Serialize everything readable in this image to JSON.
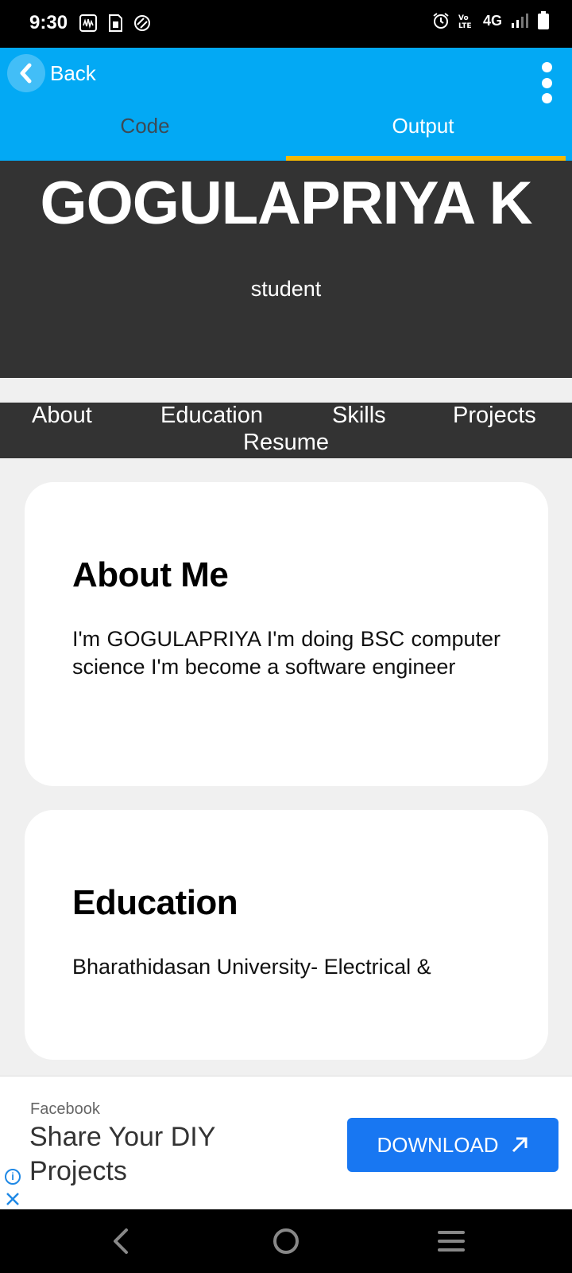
{
  "status_bar": {
    "time": "9:30",
    "network": "4G",
    "icons": [
      "activity-icon",
      "sim-icon",
      "no-disturb-icon",
      "alarm-icon",
      "volte-icon",
      "signal-icon",
      "battery-icon"
    ]
  },
  "app_bar": {
    "back_label": "Back",
    "tabs": [
      {
        "label": "Code",
        "active": false
      },
      {
        "label": "Output",
        "active": true
      }
    ],
    "accent_color": "#03a9f4",
    "underline_color": "#f5b800"
  },
  "page": {
    "hero": {
      "name": "GOGULAPRIYA K",
      "role": "student"
    },
    "nav": [
      "About",
      "Education",
      "Skills",
      "Projects",
      "Resume"
    ],
    "about": {
      "heading": "About Me",
      "text": "I'm GOGULAPRIYA I'm doing BSC computer science I'm become a software engineer"
    },
    "education": {
      "heading": "Education",
      "text": "Bharathidasan University- Electrical &"
    }
  },
  "ad": {
    "source": "Facebook",
    "headline": "Share Your DIY Projects",
    "cta": "DOWNLOAD",
    "cta_color": "#1877f2"
  }
}
